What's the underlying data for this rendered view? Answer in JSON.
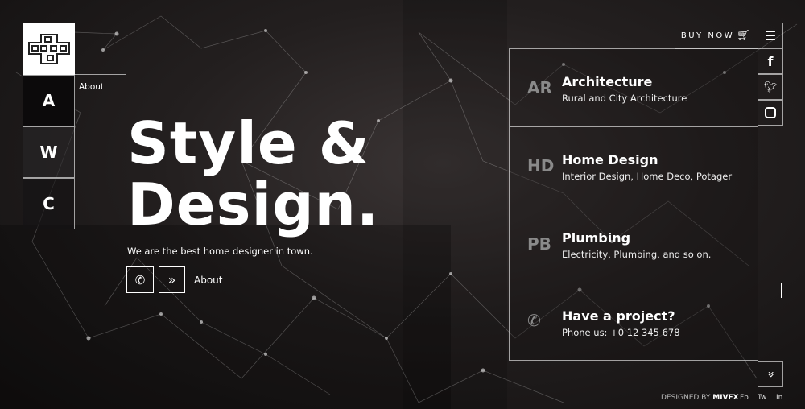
{
  "logo_label": "AWC",
  "nav": [
    {
      "label": "A"
    },
    {
      "label": "W"
    },
    {
      "label": "C"
    }
  ],
  "nav_tooltip": "About",
  "hero": {
    "line1": "Style &",
    "line2": "Design.",
    "subtitle": "We are the best home designer in town.",
    "about_link": "About"
  },
  "buy_now": "BUY NOW",
  "services": [
    {
      "abbr": "AR",
      "title": "Architecture",
      "subtitle": "Rural and City Architecture"
    },
    {
      "abbr": "HD",
      "title": "Home Design",
      "subtitle": "Interior Design, Home Deco, Potager"
    },
    {
      "abbr": "PB",
      "title": "Plumbing",
      "subtitle": "Electricity, Plumbing, and so on."
    }
  ],
  "contact": {
    "title": "Have a project?",
    "subtitle": "Phone us: +0 12 345 678"
  },
  "footer": {
    "designed_by": "DESIGNED BY",
    "brand": "MIVFX",
    "links": [
      "Fb",
      "Tw",
      "In"
    ]
  }
}
